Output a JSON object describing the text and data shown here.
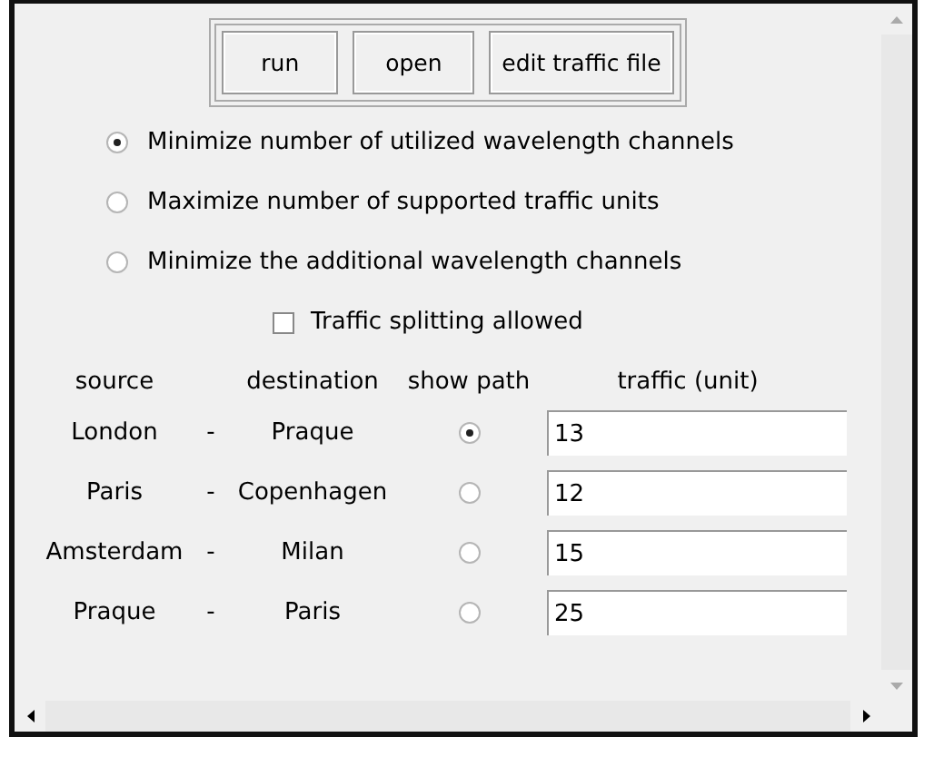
{
  "buttons": [
    "run",
    "open",
    "edit traffic file"
  ],
  "objectives": [
    {
      "label": "Minimize number of utilized wavelength channels",
      "selected": true
    },
    {
      "label": "Maximize number of supported traffic units",
      "selected": false
    },
    {
      "label": "Minimize the additional wavelength channels",
      "selected": false
    }
  ],
  "splitting": {
    "label": "Traffic splitting allowed",
    "checked": false
  },
  "table": {
    "columns": [
      "source",
      "destination",
      "show path",
      "traffic (unit)"
    ],
    "rows": [
      {
        "source": "London",
        "separator": "-",
        "destination": "Praque",
        "show_path": true,
        "traffic": "13"
      },
      {
        "source": "Paris",
        "separator": "-",
        "destination": "Copenhagen",
        "show_path": false,
        "traffic": "12"
      },
      {
        "source": "Amsterdam",
        "separator": "-",
        "destination": "Milan",
        "show_path": false,
        "traffic": "15"
      },
      {
        "source": "Praque",
        "separator": "-",
        "destination": "Paris",
        "show_path": false,
        "traffic": "25"
      }
    ]
  }
}
